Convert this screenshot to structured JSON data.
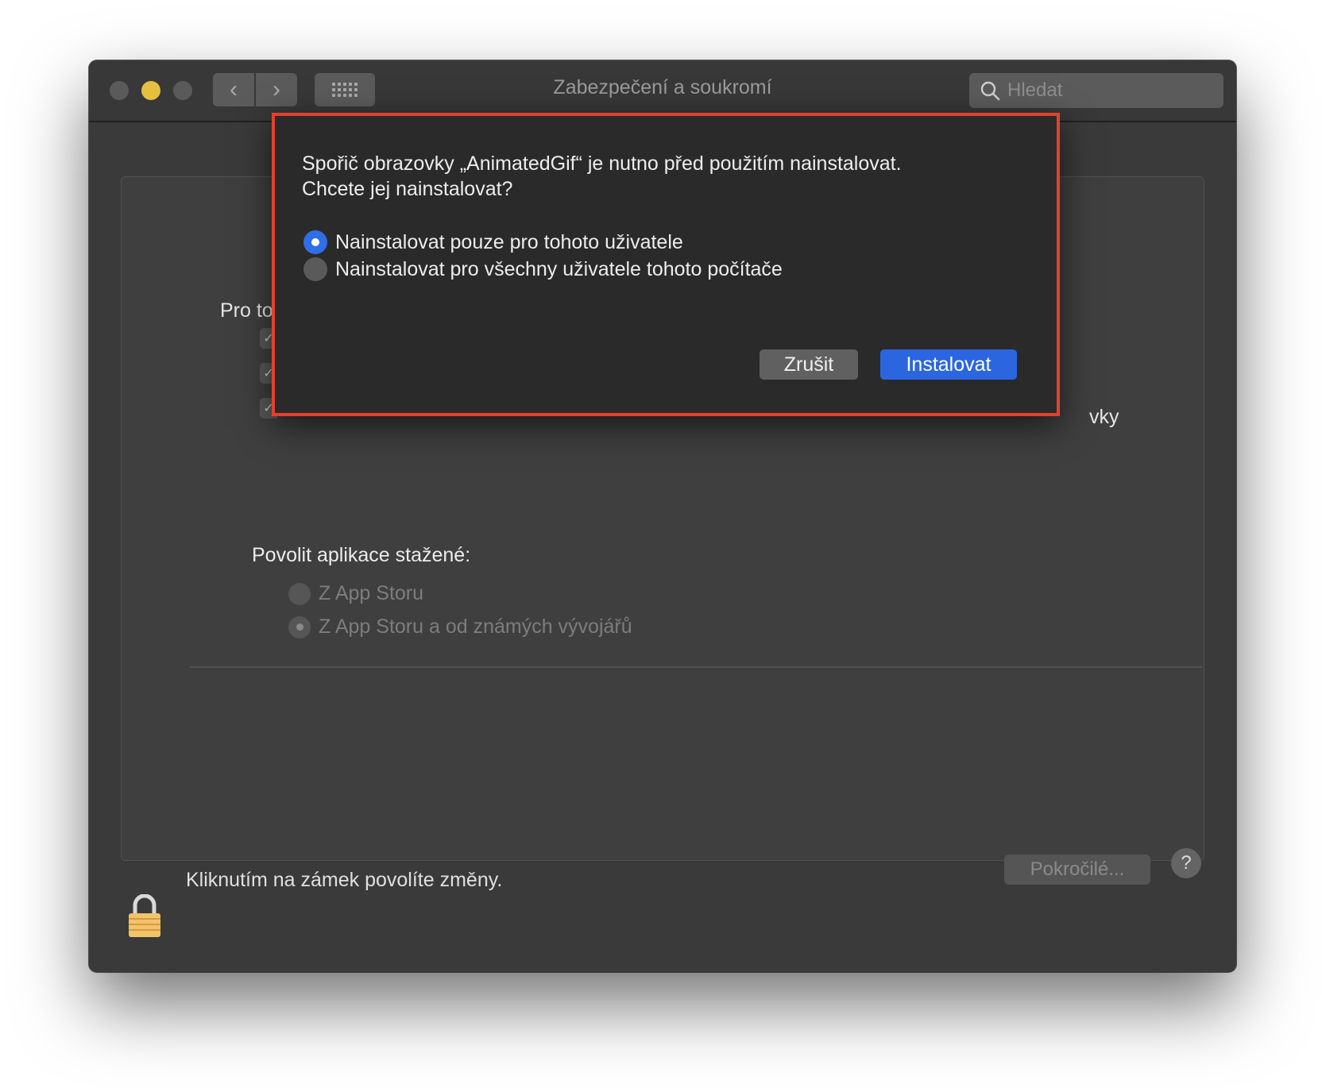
{
  "window": {
    "title": "Zabezpečení a soukromí",
    "search_placeholder": "Hledat"
  },
  "general": {
    "pro_label_fragment": "Pro to",
    "right_fragment": "vky"
  },
  "gatekeeper": {
    "title": "Povolit aplikace stažené:",
    "options": [
      {
        "label": "Z App Storu",
        "selected": false
      },
      {
        "label": "Z App Storu a od známých vývojářů",
        "selected": true
      }
    ]
  },
  "footer": {
    "lock_text": "Kliknutím na zámek povolíte změny.",
    "advanced_label": "Pokročilé...",
    "help_label": "?"
  },
  "dialog": {
    "message_line1": "Spořič obrazovky „AnimatedGif“ je nutno před použitím nainstalovat.",
    "message_line2": "Chcete jej nainstalovat?",
    "options": [
      {
        "label": "Nainstalovat pouze pro tohoto uživatele",
        "selected": true
      },
      {
        "label": "Nainstalovat pro všechny uživatele tohoto počítače",
        "selected": false
      }
    ],
    "cancel_label": "Zrušit",
    "install_label": "Instalovat",
    "highlight_color": "#e2412f",
    "accent_color": "#2b66e0"
  }
}
